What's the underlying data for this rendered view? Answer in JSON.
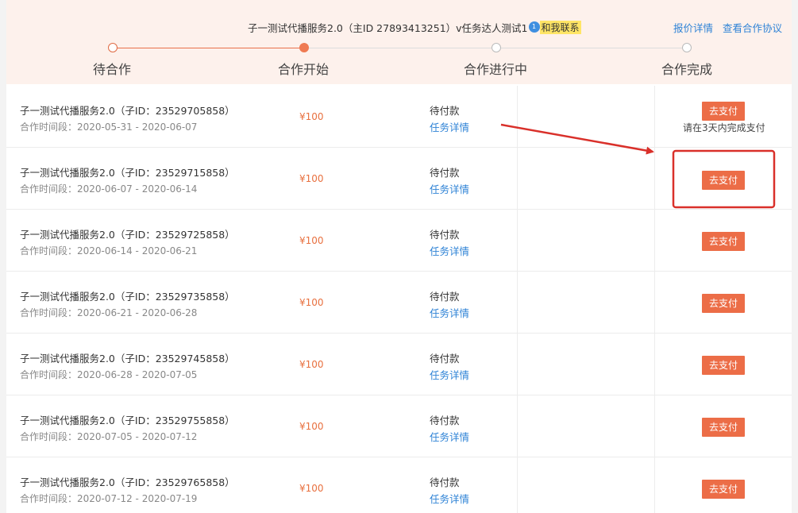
{
  "header": {
    "title": "子一测试代播服务2.0（主ID 27893413251）v任务达人测试1",
    "chat_badge_count": "1",
    "contact_label": "和我联系",
    "links": [
      "报价详情",
      "查看合作协议"
    ]
  },
  "steps": [
    {
      "label": "待合作",
      "state": "done"
    },
    {
      "label": "合作开始",
      "state": "current"
    },
    {
      "label": "合作进行中",
      "state": "todo"
    },
    {
      "label": "合作完成",
      "state": "todo"
    }
  ],
  "rows": [
    {
      "name": "子一测试代播服务2.0（子ID：23529705858）",
      "period": "合作时间段：2020-05-31 - 2020-06-07",
      "price": "¥100",
      "status": "待付款",
      "detail": "任务详情",
      "action": "去支付",
      "note": "请在3天内完成支付"
    },
    {
      "name": "子一测试代播服务2.0（子ID：23529715858）",
      "period": "合作时间段：2020-06-07 - 2020-06-14",
      "price": "¥100",
      "status": "待付款",
      "detail": "任务详情",
      "action": "去支付"
    },
    {
      "name": "子一测试代播服务2.0（子ID：23529725858）",
      "period": "合作时间段：2020-06-14 - 2020-06-21",
      "price": "¥100",
      "status": "待付款",
      "detail": "任务详情",
      "action": "去支付"
    },
    {
      "name": "子一测试代播服务2.0（子ID：23529735858）",
      "period": "合作时间段：2020-06-21 - 2020-06-28",
      "price": "¥100",
      "status": "待付款",
      "detail": "任务详情",
      "action": "去支付"
    },
    {
      "name": "子一测试代播服务2.0（子ID：23529745858）",
      "period": "合作时间段：2020-06-28 - 2020-07-05",
      "price": "¥100",
      "status": "待付款",
      "detail": "任务详情",
      "action": "去支付"
    },
    {
      "name": "子一测试代播服务2.0（子ID：23529755858）",
      "period": "合作时间段：2020-07-05 - 2020-07-12",
      "price": "¥100",
      "status": "待付款",
      "detail": "任务详情",
      "action": "去支付"
    },
    {
      "name": "子一测试代播服务2.0（子ID：23529765858）",
      "period": "合作时间段：2020-07-12 - 2020-07-19",
      "price": "¥100",
      "status": "待付款",
      "detail": "任务详情",
      "action": "去支付"
    }
  ],
  "colors": {
    "accent": "#ec6d47",
    "link": "#2f83d6",
    "header_bg": "#fdf1ec",
    "annotation": "#d9302a"
  }
}
